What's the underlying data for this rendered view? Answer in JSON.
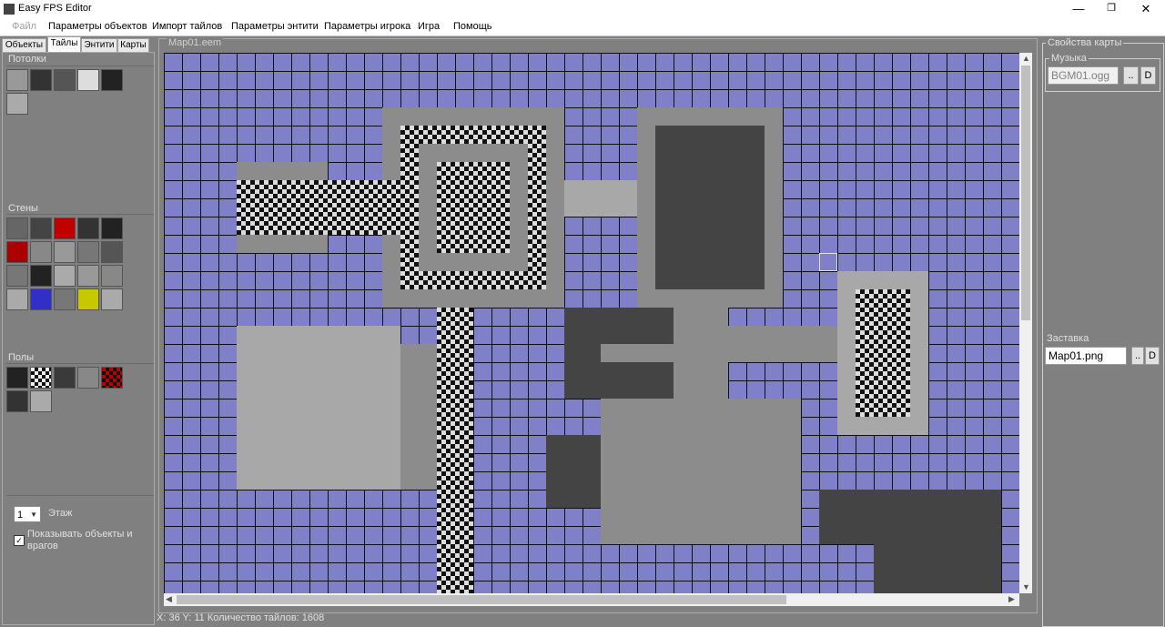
{
  "window": {
    "title": "Easy FPS Editor",
    "minimize": "—",
    "restore": "❐",
    "close": "✕"
  },
  "menu": [
    {
      "label": "Файл",
      "disabled": true
    },
    {
      "label": "Параметры объектов"
    },
    {
      "label": "Импорт тайлов"
    },
    {
      "label": "Параметры энтити"
    },
    {
      "label": "Параметры игрока"
    },
    {
      "label": "Игра"
    },
    {
      "label": "Помощь"
    }
  ],
  "tabs": [
    "Объекты",
    "Тайлы",
    "Энтити",
    "Карты"
  ],
  "active_tab": "Тайлы",
  "left": {
    "ceilings_label": "Потолки",
    "walls_label": "Стены",
    "floors_label": "Полы",
    "floor_value": "1",
    "floor_label": "Этаж",
    "show_objects_label": "Показывать объекты и врагов",
    "show_objects_checked": "✓"
  },
  "map": {
    "legend": "Map01.eem",
    "status": "X: 36 Y: 11 Количество тайлов: 1608"
  },
  "right": {
    "map_props_title": "Свойства карты",
    "music_title": "Музыка",
    "music_value": "BGM01.ogg",
    "browse_label": "..",
    "clear_label": "D",
    "splash_label": "Заставка",
    "splash_value": "Map01.png"
  },
  "colors": {
    "map_bg": "#8080c8",
    "grid": "#101018",
    "panel": "#808080"
  }
}
